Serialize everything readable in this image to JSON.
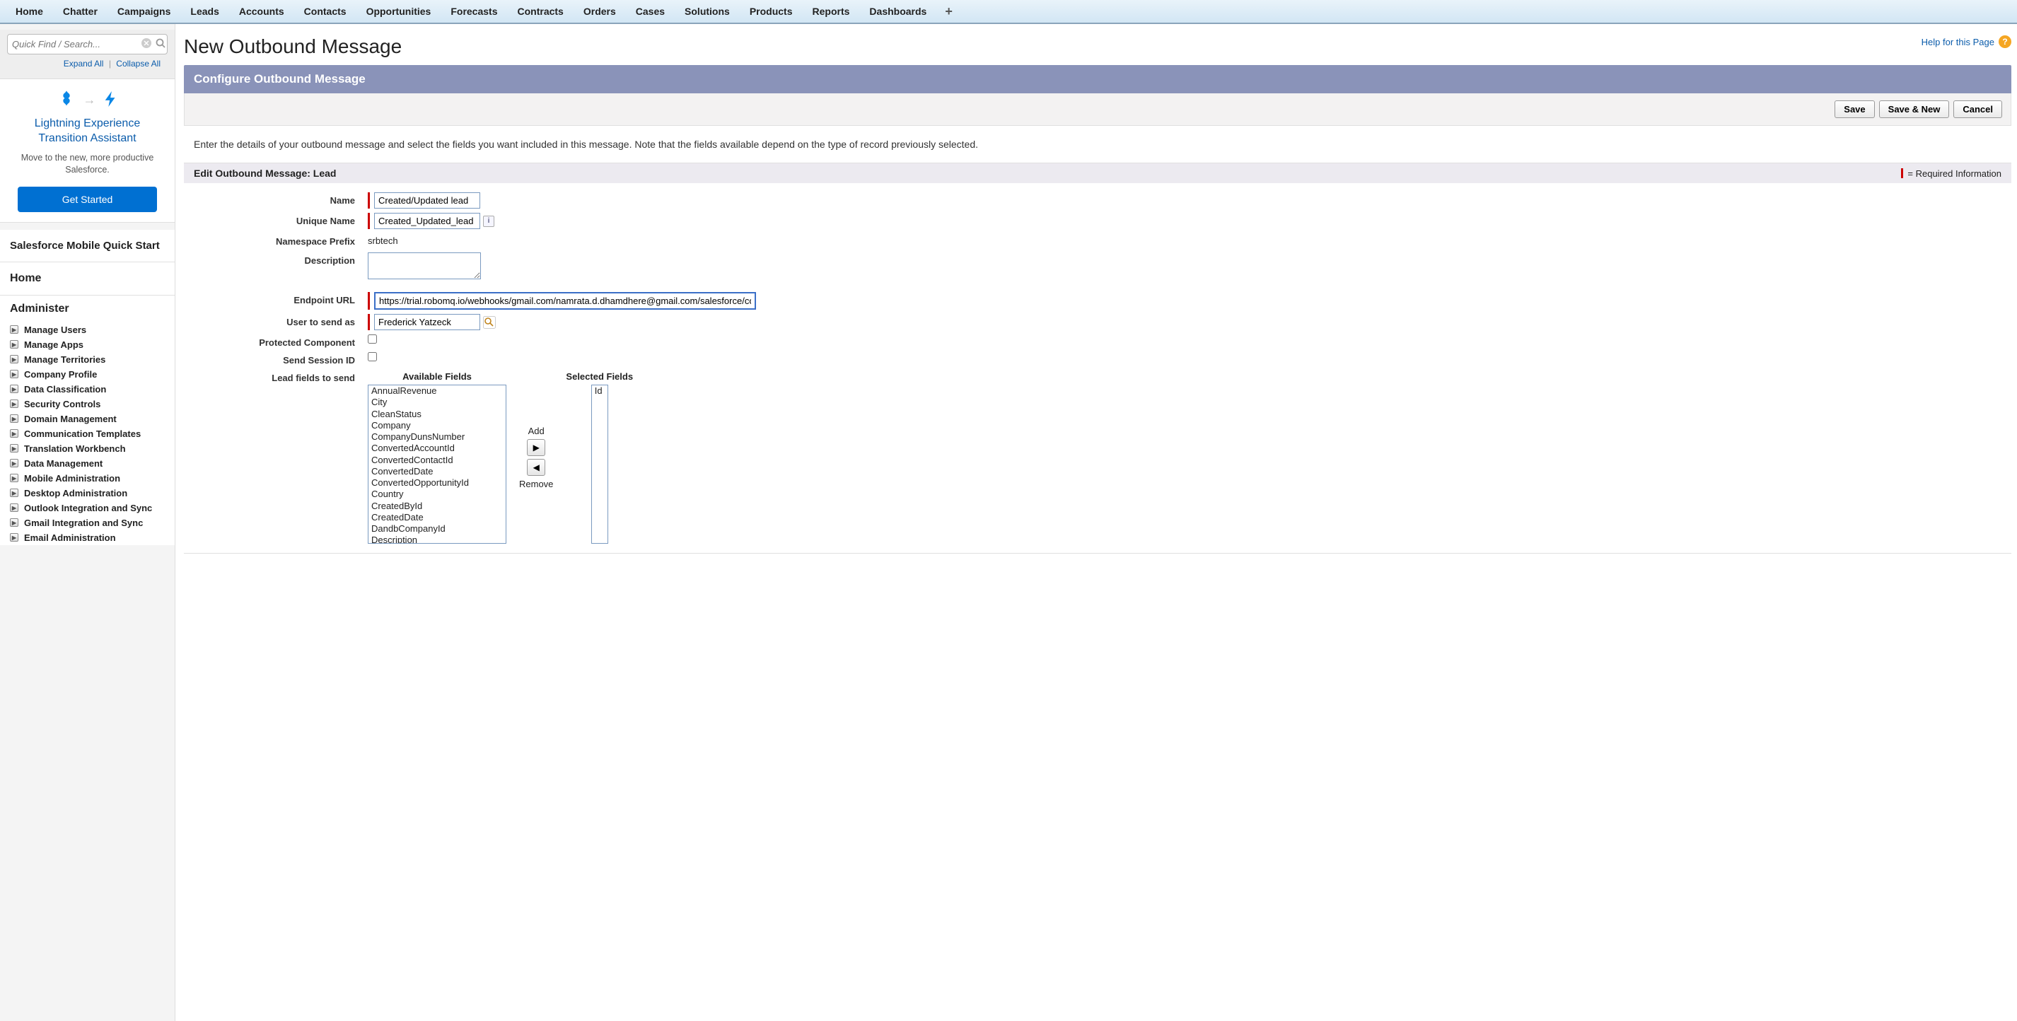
{
  "topnav": {
    "tabs": [
      "Home",
      "Chatter",
      "Campaigns",
      "Leads",
      "Accounts",
      "Contacts",
      "Opportunities",
      "Forecasts",
      "Contracts",
      "Orders",
      "Cases",
      "Solutions",
      "Products",
      "Reports",
      "Dashboards"
    ],
    "plus_tooltip": "+"
  },
  "sidebar": {
    "quickfind_placeholder": "Quick Find / Search...",
    "expand_all": "Expand All",
    "collapse_all": "Collapse All",
    "lex": {
      "title": "Lightning Experience Transition Assistant",
      "subtitle": "Move to the new, more productive Salesforce.",
      "button": "Get Started"
    },
    "quick_start_title": "Salesforce Mobile Quick Start",
    "home_label": "Home",
    "admin_heading": "Administer",
    "admin_items": [
      "Manage Users",
      "Manage Apps",
      "Manage Territories",
      "Company Profile",
      "Data Classification",
      "Security Controls",
      "Domain Management",
      "Communication Templates",
      "Translation Workbench",
      "Data Management",
      "Mobile Administration",
      "Desktop Administration",
      "Outlook Integration and Sync",
      "Gmail Integration and Sync",
      "Email Administration"
    ]
  },
  "page": {
    "title": "New Outbound Message",
    "help_text": "Help for this Page",
    "section_header": "Configure Outbound Message",
    "buttons": {
      "save": "Save",
      "save_new": "Save & New",
      "cancel": "Cancel"
    },
    "instruction": "Enter the details of your outbound message and select the fields you want included in this message. Note that the fields available depend on the type of record previously selected.",
    "edit_header": "Edit Outbound Message: Lead",
    "required_info": "= Required Information"
  },
  "form": {
    "labels": {
      "name": "Name",
      "unique": "Unique Name",
      "ns": "Namespace Prefix",
      "desc": "Description",
      "url": "Endpoint URL",
      "user": "User to send as",
      "protected": "Protected Component",
      "session": "Send Session ID",
      "fields": "Lead fields to send"
    },
    "values": {
      "name": "Created/Updated lead",
      "unique": "Created_Updated_lead",
      "ns": "srbtech",
      "desc": "",
      "url": "https://trial.robomq.io/webhooks/gmail.com/namrata.d.dhamdhere@gmail.com/salesforce/co",
      "user": "Frederick Yatzeck",
      "protected": false,
      "session": false
    },
    "dual": {
      "avail_header": "Available Fields",
      "sel_header": "Selected Fields",
      "add_label": "Add",
      "remove_label": "Remove",
      "available": [
        "AnnualRevenue",
        "City",
        "CleanStatus",
        "Company",
        "CompanyDunsNumber",
        "ConvertedAccountId",
        "ConvertedContactId",
        "ConvertedDate",
        "ConvertedOpportunityId",
        "Country",
        "CreatedById",
        "CreatedDate",
        "DandbCompanyId",
        "Description"
      ],
      "selected": [
        "Id"
      ]
    }
  }
}
